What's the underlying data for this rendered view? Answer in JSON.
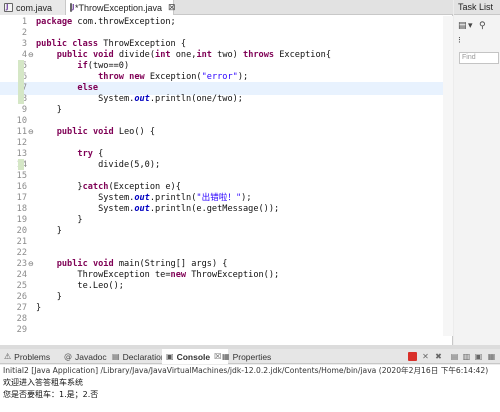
{
  "editor": {
    "tabs": [
      {
        "label": "com.java",
        "active": false
      },
      {
        "label": "*ThrowException.java",
        "active": true
      }
    ],
    "close_glyph": "⊠",
    "lines": [
      {
        "n": "1",
        "code": "package com.throwException;"
      },
      {
        "n": "2",
        "code": ""
      },
      {
        "n": "3",
        "code": "public class ThrowException {"
      },
      {
        "n": "4",
        "code": "    public void divide(int one,int two) throws Exception{",
        "overview": "⊖"
      },
      {
        "n": "5",
        "code": "        if(two==0)"
      },
      {
        "n": "6",
        "code": "            throw new Exception(\"error\");"
      },
      {
        "n": "7",
        "code": "        else",
        "highlight": true
      },
      {
        "n": "8",
        "code": "            System.out.println(one/two);"
      },
      {
        "n": "9",
        "code": "    }"
      },
      {
        "n": "10",
        "code": ""
      },
      {
        "n": "11",
        "code": "    public void Leo() {",
        "overview": "⊖"
      },
      {
        "n": "12",
        "code": ""
      },
      {
        "n": "13",
        "code": "        try {"
      },
      {
        "n": "14",
        "code": "            divide(5,0);"
      },
      {
        "n": "15",
        "code": ""
      },
      {
        "n": "16",
        "code": "        }catch(Exception e){"
      },
      {
        "n": "17",
        "code": "            System.out.println(\"出错啦！\");"
      },
      {
        "n": "18",
        "code": "            System.out.println(e.getMessage());"
      },
      {
        "n": "19",
        "code": "        }"
      },
      {
        "n": "20",
        "code": "    }"
      },
      {
        "n": "21",
        "code": ""
      },
      {
        "n": "22",
        "code": ""
      },
      {
        "n": "23",
        "code": "    public void main(String[] args) {",
        "overview": "⊖"
      },
      {
        "n": "24",
        "code": "        ThrowException te=new ThrowException();"
      },
      {
        "n": "25",
        "code": "        te.Leo();"
      },
      {
        "n": "26",
        "code": "    }"
      },
      {
        "n": "27",
        "code": "}"
      },
      {
        "n": "28",
        "code": ""
      },
      {
        "n": "29",
        "code": ""
      }
    ]
  },
  "right_panel": {
    "title": "Task List",
    "find_placeholder": "Find"
  },
  "console": {
    "tabs": [
      {
        "label": "Problems",
        "icon": "⚠"
      },
      {
        "label": "Javadoc",
        "icon": "@"
      },
      {
        "label": "Declaration",
        "icon": "▤"
      },
      {
        "label": "Console",
        "icon": "▣",
        "active": true,
        "suffix": "☒"
      },
      {
        "label": "Properties",
        "icon": "▦"
      }
    ],
    "status": "Initial2 [Java Application] /Library/Java/JavaVirtualMachines/jdk-12.0.2.jdk/Contents/Home/bin/java (2020年2月16日 下午6:14:42)",
    "output": [
      "欢迎进入答答租车系统",
      "您是否要租车：1.是；2.否"
    ]
  }
}
